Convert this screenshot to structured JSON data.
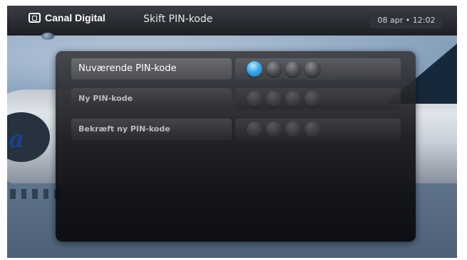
{
  "header": {
    "brand": "Canal Digital",
    "title": "Skift PIN-kode",
    "datetime": "08 apr • 12:02"
  },
  "background": {
    "aircraft_letter": "a"
  },
  "pin_form": {
    "rows": [
      {
        "label": "Nuværende PIN-kode",
        "digits_total": 4,
        "focused_digit": 1,
        "active": true
      },
      {
        "label": "Ny PIN-kode",
        "digits_total": 4,
        "active": false
      },
      {
        "label": "Bekræft ny PIN-kode",
        "digits_total": 4,
        "active": false
      }
    ]
  },
  "colors": {
    "accent": "#3aa8e8",
    "header_bg": "#1d1f24"
  }
}
